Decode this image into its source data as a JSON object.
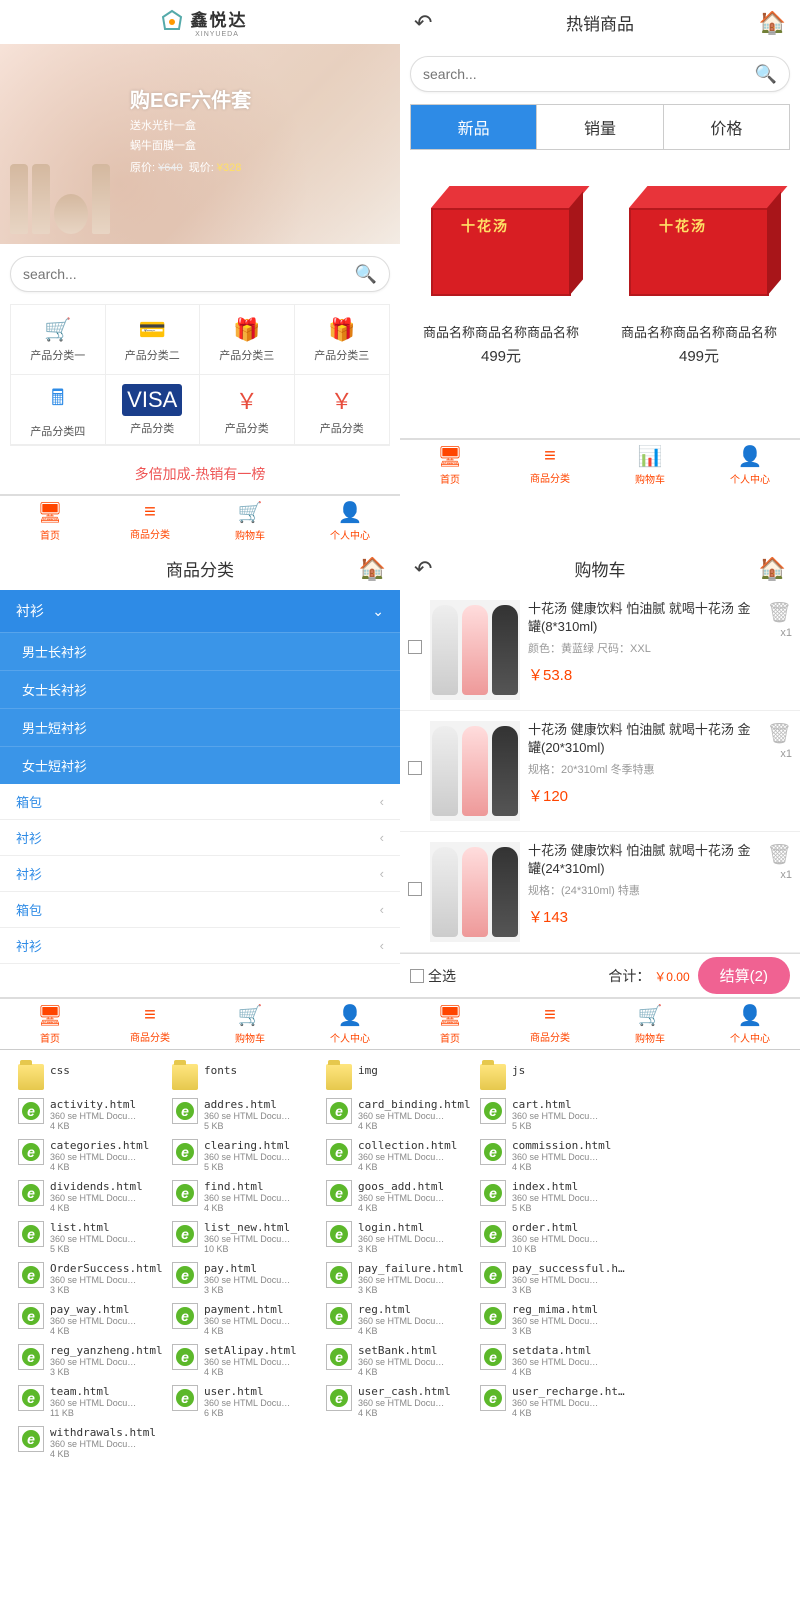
{
  "logo_text": "鑫悦达",
  "logo_sub": "XINYUEDA",
  "banner": {
    "title": "购EGF六件套",
    "sub1": "送水光针一盒",
    "sub2": "蜗牛面膜一盒",
    "old_label": "原价:",
    "old": "¥640",
    "new_label": "现价:",
    "new": "¥328"
  },
  "search_placeholder": "search...",
  "cats": [
    "产品分类一",
    "产品分类二",
    "产品分类三",
    "产品分类三",
    "产品分类四",
    "产品分类",
    "产品分类",
    "产品分类"
  ],
  "promo": "多倍加成-热销有一榜",
  "tabbar": [
    "首页",
    "商品分类",
    "购物车",
    "个人中心"
  ],
  "hotsell_title": "热销商品",
  "sorttabs": [
    "新品",
    "销量",
    "价格"
  ],
  "products": [
    {
      "name": "商品名称商品名称商品名称",
      "price": "499元",
      "box_label": "十花汤"
    },
    {
      "name": "商品名称商品名称商品名称",
      "price": "499元",
      "box_label": "十花汤"
    }
  ],
  "catpage_title": "商品分类",
  "cat_open": "衬衫",
  "cat_subs": [
    "男士长衬衫",
    "女士长衬衫",
    "男士短衬衫",
    "女士短衬衫"
  ],
  "cat_links": [
    "箱包",
    "衬衫",
    "衬衫",
    "箱包",
    "衬衫"
  ],
  "cart_title": "购物车",
  "cart_items": [
    {
      "title": "十花汤 健康饮料 怕油腻 就喝十花汤 金罐(8*310ml)",
      "spec": "颜色：黄蓝绿 尺码：XXL",
      "price": "￥53.8",
      "qty": "x1"
    },
    {
      "title": "十花汤 健康饮料 怕油腻 就喝十花汤 金罐(20*310ml)",
      "spec": "规格：20*310ml 冬季特惠",
      "price": "￥120",
      "qty": "x1"
    },
    {
      "title": "十花汤 健康饮料 怕油腻 就喝十花汤 金罐(24*310ml)",
      "spec": "规格：(24*310ml) 特惠",
      "price": "￥143",
      "qty": "x1"
    }
  ],
  "select_all": "全选",
  "total_label": "合计：",
  "total_amount": "￥0.00",
  "checkout": "结算(2)",
  "files": [
    {
      "name": "css",
      "type": "folder"
    },
    {
      "name": "fonts",
      "type": "folder"
    },
    {
      "name": "img",
      "type": "folder"
    },
    {
      "name": "js",
      "type": "folder"
    },
    {
      "name": "activity.html",
      "type": "html",
      "meta": "360 se HTML Docu…",
      "size": "4 KB"
    },
    {
      "name": "addres.html",
      "type": "html",
      "meta": "360 se HTML Docu…",
      "size": "5 KB"
    },
    {
      "name": "card_binding.html",
      "type": "html",
      "meta": "360 se HTML Docu…",
      "size": "4 KB"
    },
    {
      "name": "cart.html",
      "type": "html",
      "meta": "360 se HTML Docu…",
      "size": "5 KB"
    },
    {
      "name": "categories.html",
      "type": "html",
      "meta": "360 se HTML Docu…",
      "size": "4 KB"
    },
    {
      "name": "clearing.html",
      "type": "html",
      "meta": "360 se HTML Docu…",
      "size": "5 KB"
    },
    {
      "name": "collection.html",
      "type": "html",
      "meta": "360 se HTML Docu…",
      "size": "4 KB"
    },
    {
      "name": "commission.html",
      "type": "html",
      "meta": "360 se HTML Docu…",
      "size": "4 KB"
    },
    {
      "name": "dividends.html",
      "type": "html",
      "meta": "360 se HTML Docu…",
      "size": "4 KB"
    },
    {
      "name": "find.html",
      "type": "html",
      "meta": "360 se HTML Docu…",
      "size": "4 KB"
    },
    {
      "name": "goos_add.html",
      "type": "html",
      "meta": "360 se HTML Docu…",
      "size": "4 KB"
    },
    {
      "name": "index.html",
      "type": "html",
      "meta": "360 se HTML Docu…",
      "size": "5 KB"
    },
    {
      "name": "list.html",
      "type": "html",
      "meta": "360 se HTML Docu…",
      "size": "5 KB"
    },
    {
      "name": "list_new.html",
      "type": "html",
      "meta": "360 se HTML Docu…",
      "size": "10 KB"
    },
    {
      "name": "login.html",
      "type": "html",
      "meta": "360 se HTML Docu…",
      "size": "3 KB"
    },
    {
      "name": "order.html",
      "type": "html",
      "meta": "360 se HTML Docu…",
      "size": "10 KB"
    },
    {
      "name": "OrderSuccess.html",
      "type": "html",
      "meta": "360 se HTML Docu…",
      "size": "3 KB"
    },
    {
      "name": "pay.html",
      "type": "html",
      "meta": "360 se HTML Docu…",
      "size": "3 KB"
    },
    {
      "name": "pay_failure.html",
      "type": "html",
      "meta": "360 se HTML Docu…",
      "size": "3 KB"
    },
    {
      "name": "pay_successful.html",
      "type": "html",
      "meta": "360 se HTML Docu…",
      "size": "3 KB"
    },
    {
      "name": "pay_way.html",
      "type": "html",
      "meta": "360 se HTML Docu…",
      "size": "4 KB"
    },
    {
      "name": "payment.html",
      "type": "html",
      "meta": "360 se HTML Docu…",
      "size": "4 KB"
    },
    {
      "name": "reg.html",
      "type": "html",
      "meta": "360 se HTML Docu…",
      "size": "4 KB"
    },
    {
      "name": "reg_mima.html",
      "type": "html",
      "meta": "360 se HTML Docu…",
      "size": "3 KB"
    },
    {
      "name": "reg_yanzheng.html",
      "type": "html",
      "meta": "360 se HTML Docu…",
      "size": "3 KB"
    },
    {
      "name": "setAlipay.html",
      "type": "html",
      "meta": "360 se HTML Docu…",
      "size": "4 KB"
    },
    {
      "name": "setBank.html",
      "type": "html",
      "meta": "360 se HTML Docu…",
      "size": "4 KB"
    },
    {
      "name": "setdata.html",
      "type": "html",
      "meta": "360 se HTML Docu…",
      "size": "4 KB"
    },
    {
      "name": "team.html",
      "type": "html",
      "meta": "360 se HTML Docu…",
      "size": "11 KB"
    },
    {
      "name": "user.html",
      "type": "html",
      "meta": "360 se HTML Docu…",
      "size": "6 KB"
    },
    {
      "name": "user_cash.html",
      "type": "html",
      "meta": "360 se HTML Docu…",
      "size": "4 KB"
    },
    {
      "name": "user_recharge.html",
      "type": "html",
      "meta": "360 se HTML Docu…",
      "size": "4 KB"
    },
    {
      "name": "withdrawals.html",
      "type": "html",
      "meta": "360 se HTML Docu…",
      "size": "4 KB"
    }
  ]
}
